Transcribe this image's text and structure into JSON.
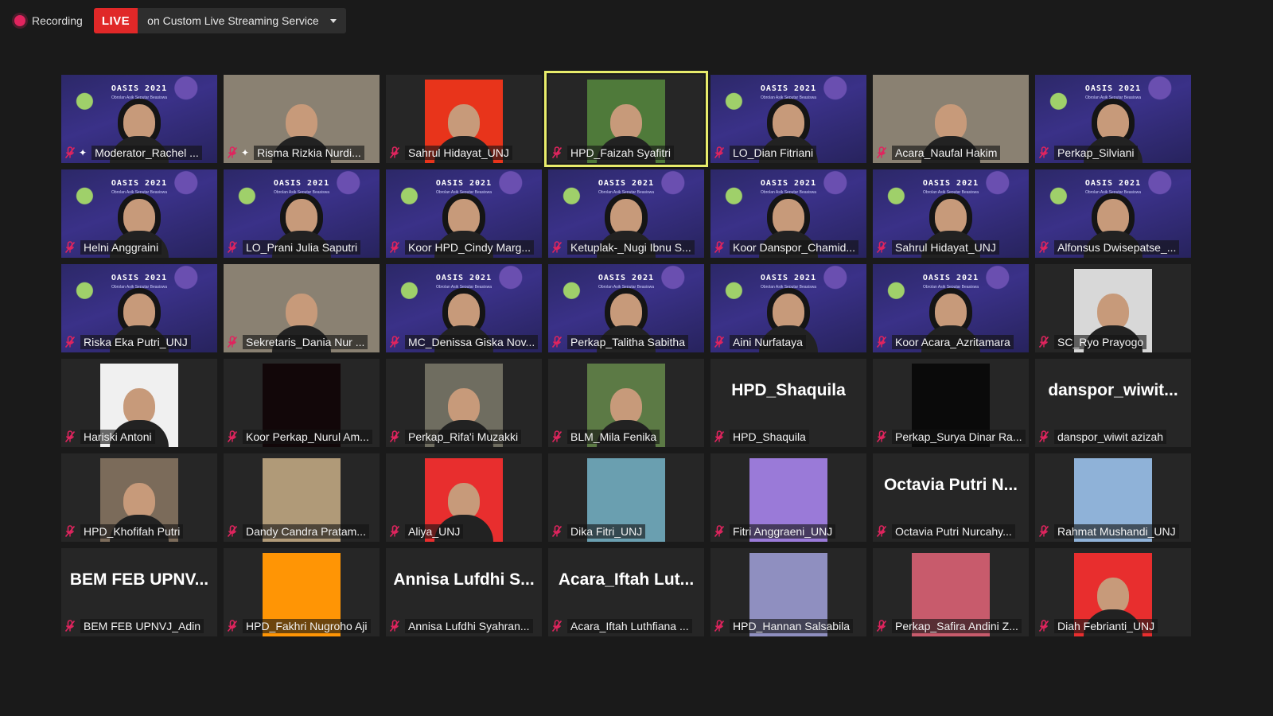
{
  "topbar": {
    "recording_label": "Recording",
    "live_label": "LIVE",
    "service_label": "on Custom Live Streaming Service"
  },
  "colors": {
    "live": "#e02828",
    "active_speaker_border": "#e8ec6b",
    "muted_icon": "#e0245e"
  },
  "oasis": {
    "title": "OASIS 2021",
    "subtitle": "Obrolan Asik Seputar Beasiswa"
  },
  "participants": [
    {
      "name": "Moderator_Rachel ...",
      "video": "oasis",
      "pinned": true
    },
    {
      "name": "Risma Rizkia Nurdi...",
      "video": "camera",
      "pinned": true
    },
    {
      "name": "Sahrul Hidayat_UNJ",
      "video": "photo-red"
    },
    {
      "name": "HPD_Faizah Syafitri",
      "video": "photo-field",
      "active": true
    },
    {
      "name": "LO_Dian Fitriani",
      "video": "oasis"
    },
    {
      "name": "Acara_Naufal Hakim",
      "video": "camera"
    },
    {
      "name": "Perkap_Silviani",
      "video": "oasis"
    },
    {
      "name": "Helni Anggraini",
      "video": "oasis"
    },
    {
      "name": "LO_Prani Julia Saputri",
      "video": "oasis"
    },
    {
      "name": "Koor HPD_Cindy Marg...",
      "video": "oasis"
    },
    {
      "name": "Ketuplak-_Nugi Ibnu S...",
      "video": "oasis"
    },
    {
      "name": "Koor Danspor_Chamid...",
      "video": "oasis"
    },
    {
      "name": "Sahrul Hidayat_UNJ",
      "video": "oasis"
    },
    {
      "name": "Alfonsus Dwisepatse_...",
      "video": "oasis"
    },
    {
      "name": "Riska Eka Putri_UNJ",
      "video": "oasis"
    },
    {
      "name": "Sekretaris_Dania Nur ...",
      "video": "camera"
    },
    {
      "name": "MC_Denissa Giska Nov...",
      "video": "oasis"
    },
    {
      "name": "Perkap_Talitha Sabitha",
      "video": "oasis"
    },
    {
      "name": "Aini Nurfataya",
      "video": "oasis"
    },
    {
      "name": "Koor Acara_Azritamara",
      "video": "oasis"
    },
    {
      "name": "SC_Ryo Prayogo",
      "video": "photo-grey"
    },
    {
      "name": "Hariski Antoni",
      "video": "photo-white"
    },
    {
      "name": "Koor Perkap_Nurul Am...",
      "video": "photo-dark"
    },
    {
      "name": "Perkap_Rifa'i Muzakki",
      "video": "photo-car"
    },
    {
      "name": "BLM_Mila Fenika",
      "video": "photo-park"
    },
    {
      "name": "HPD_Shaquila",
      "video": "text",
      "display": "HPD_Shaquila"
    },
    {
      "name": "Perkap_Surya Dinar Ra...",
      "video": "photo-black"
    },
    {
      "name": "danspor_wiwit azizah",
      "video": "text",
      "display": "danspor_wiwit..."
    },
    {
      "name": "HPD_Khofifah Putri",
      "video": "photo-cat"
    },
    {
      "name": "Dandy Candra Pratam...",
      "video": "photo-painting"
    },
    {
      "name": "Aliya_UNJ",
      "video": "photo-red-hijab"
    },
    {
      "name": "Dika Fitri_UNJ",
      "video": "photo-tower"
    },
    {
      "name": "Fitri Anggraeni_UNJ",
      "video": "photo-anime"
    },
    {
      "name": "Octavia Putri Nurcahy...",
      "video": "text",
      "display": "Octavia Putri N..."
    },
    {
      "name": "Rahmat Mushandi_UNJ",
      "video": "photo-sky"
    },
    {
      "name": "BEM FEB UPNVJ_Adin",
      "video": "text",
      "display": "BEM FEB UPNV..."
    },
    {
      "name": "HPD_Fakhri Nugroho Aji",
      "video": "photo-orange"
    },
    {
      "name": "Annisa Lufdhi Syahran...",
      "video": "text",
      "display": "Annisa Lufdhi S..."
    },
    {
      "name": "Acara_Iftah Luthfiana ...",
      "video": "text",
      "display": "Acara_Iftah Lut..."
    },
    {
      "name": "HPD_Hannan Salsabila",
      "video": "photo-cartoon"
    },
    {
      "name": "Perkap_Safira Andini Z...",
      "video": "photo-paint"
    },
    {
      "name": "Diah Febrianti_UNJ",
      "video": "photo-red-hijab2"
    }
  ]
}
